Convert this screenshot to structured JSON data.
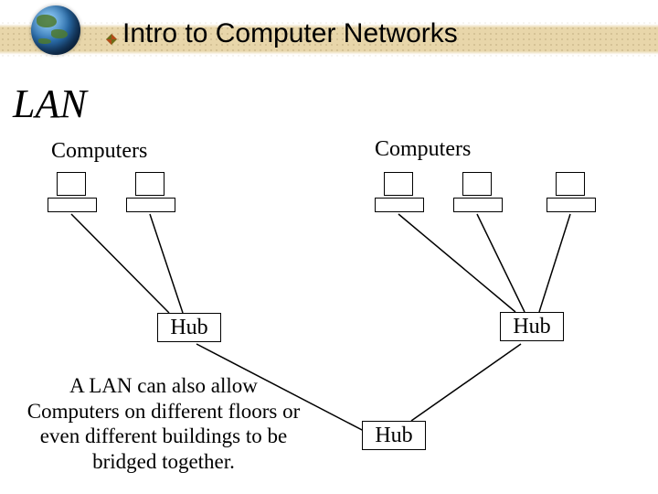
{
  "header": {
    "title": "Intro to Computer Networks"
  },
  "section": {
    "heading": "LAN"
  },
  "labels": {
    "computers_left": "Computers",
    "computers_right": "Computers",
    "hub_left": "Hub",
    "hub_right": "Hub",
    "hub_bottom": "Hub"
  },
  "description": "A LAN can also allow Computers on different floors or even different buildings to be bridged together.",
  "colors": {
    "band": "#e8d6aa",
    "bullet_olive": "#6e6b17",
    "bullet_rust": "#b34a17"
  }
}
